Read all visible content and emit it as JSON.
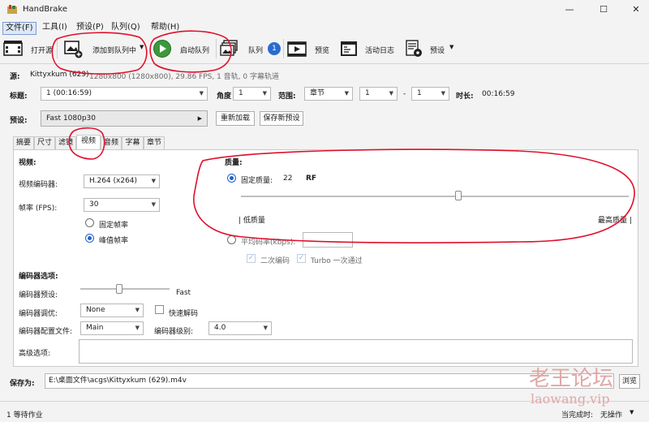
{
  "window": {
    "title": "HandBrake",
    "controls": {
      "minimize": "—",
      "maximize": "☐",
      "close": "✕"
    }
  },
  "menu": [
    "文件(F)",
    "工具(I)",
    "预设(P)",
    "队列(Q)",
    "帮助(H)"
  ],
  "toolbar": {
    "open_source": "打开源",
    "add_to_queue": "添加到队列中",
    "start_queue": "启动队列",
    "queue": "队列",
    "queue_count": "1",
    "preview": "预览",
    "activity_log": "活动日志",
    "presets": "预设"
  },
  "source": {
    "label": "源:",
    "name": "Kittyxkum (629)",
    "info": "1280x800 (1280x800), 29.86 FPS, 1 音轨, 0 字幕轨道"
  },
  "title_row": {
    "title_label": "标题:",
    "title_value": "1 (00:16:59)",
    "angle_label": "角度",
    "angle_value": "1",
    "range_label": "范围:",
    "range_value": "章节",
    "range_start": "1",
    "range_sep": "-",
    "range_end": "1",
    "duration_label": "时长:",
    "duration_value": "00:16:59"
  },
  "preset_row": {
    "label": "预设:",
    "value": "Fast 1080p30",
    "reload": "重新加载",
    "save_new": "保存新预设"
  },
  "tabs": [
    "摘要",
    "尺寸",
    "滤镜",
    "视频",
    "音频",
    "字幕",
    "章节"
  ],
  "video": {
    "section_title": "视频:",
    "encoder_label": "视频编码器:",
    "encoder_value": "H.264 (x264)",
    "fps_label": "帧率 (FPS):",
    "fps_value": "30",
    "constant_fr": "固定帧率",
    "peak_fr": "峰值帧率"
  },
  "quality": {
    "section_title": "质量:",
    "constant_quality": "固定质量:",
    "cq_value": "22",
    "cq_unit": "RF",
    "slider_fraction": 0.56,
    "low": "| 低质量",
    "high": "最高质量 |",
    "avg_bitrate": "平均码率(kbps):",
    "two_pass": "二次编码",
    "turbo": "Turbo 一次通过"
  },
  "encoder_options": {
    "section_title": "编码器选项:",
    "preset_label": "编码器预设:",
    "preset_value": "Fast",
    "tune_label": "编码器调优:",
    "tune_value": "None",
    "fast_decode": "快速解码",
    "profile_label": "编码器配置文件:",
    "profile_value": "Main",
    "level_label": "编码器级别:",
    "level_value": "4.0",
    "advanced_label": "高级选项:"
  },
  "save": {
    "label": "保存为:",
    "path": "E:\\桌面文件\\acgs\\Kittyxkum (629).m4v",
    "browse": "浏览"
  },
  "status": {
    "left": "1 等待作业",
    "when_done_label": "当完成时:",
    "when_done_value": "无操作"
  },
  "watermark": {
    "line1": "老王论坛",
    "line2": "laowang.vip"
  },
  "colors": {
    "accent": "#1f62c8",
    "annotation": "#e0102c",
    "start_green": "#3a9a3a"
  }
}
